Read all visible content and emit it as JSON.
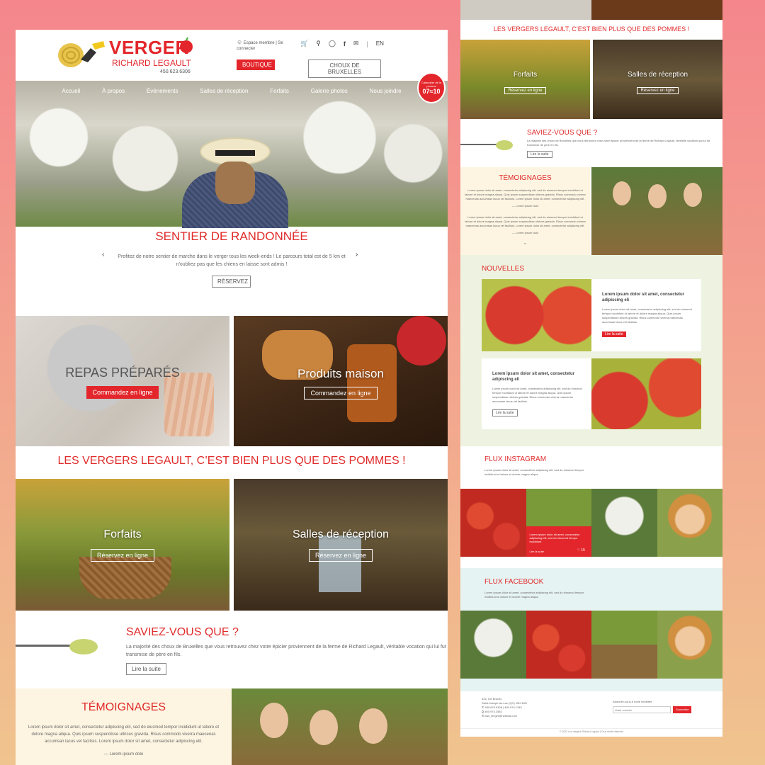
{
  "header": {
    "logo_main": "VERGER",
    "logo_sub": "RICHARD LEGAULT",
    "phone": "450.623.6306",
    "member_link": "Espace membre | Se connecter",
    "boutique": "BOUTIQUE",
    "choux": "CHOUX DE BRUXELLES",
    "lang": "EN",
    "cart_count": "0"
  },
  "nav": [
    "Accueil",
    "À propos",
    "Événements",
    "Salles de réception",
    "Forfaits",
    "Galerie photos",
    "Nous joindre"
  ],
  "calendar": {
    "label": "Calendrier de la pomme",
    "dates": "07≈10"
  },
  "hero": {
    "title": "SENTIER DE RANDONNÉE",
    "text": "Profitez de notre sentier de marche dans le verger tous les week-ends ! Le parcours total est de 5 km et n'oubliez pas que les chiens en laisse sont admis !",
    "button": "RÉSERVEZ"
  },
  "tiles": [
    {
      "title": "REPAS PRÉPARÉS",
      "button": "Commandez en ligne"
    },
    {
      "title": "Produits maison",
      "button": "Commandez en ligne"
    }
  ],
  "tagline": "LES VERGERS LEGAULT, C’EST BIEN PLUS QUE DES POMMES !",
  "offers": [
    {
      "title": "Forfaits",
      "button": "Réservez en ligne"
    },
    {
      "title": "Salles de réception",
      "button": "Réservez en ligne"
    }
  ],
  "saviez": {
    "title": "SAVIEZ-VOUS QUE ?",
    "text": "La majorité des choux de Bruxelles que vous retrouvez chez votre épicier proviennent de la ferme de Richard Legault, véritable vocation qui lui fut transmise de père en fils.",
    "text_right": "La majorité des choux de Bruxelles que vous retrouvez chez votre épicier proviennent de la ferme de Richard Legault, véritable vocation qui lui fut transmise de père en fils.",
    "button": "Lire la suite"
  },
  "testimonials": {
    "title": "TÉMOIGNAGES",
    "text": "Lorem ipsum dolor sit amet, consectetur adipiscing elit, sed do eiusmod tempor incididunt ut labore et dolore magna aliqua. Quis ipsum suspendisse ultrices gravida. Risus commodo viverra maecenas accumsan lacus vel facilisis. Lorem ipsum dolor sit amet, consectetur adipiscing elit.",
    "author": "— Lorem ipsum dolo"
  },
  "news": {
    "title": "NOUVELLES",
    "items": [
      {
        "headline": "Lorem ipsum dolor sit amet, consectetur adipiscing eli",
        "text": "Lorem ipsum dolor sit amet, consectetur adipiscing elit, sed do eiusmod tempor incididunt ut labore et dolore magna aliqua. Quis ipsum suspendisse ultrices gravida. Risus commodo viverra maecenas accumsan lacus vel facilisis.",
        "button": "Lire la suite"
      },
      {
        "headline": "Lorem ipsum dolor sit amet, consectetur adipiscing eli",
        "text": "Lorem ipsum dolor sit amet, consectetur adipiscing elit, sed do eiusmod tempor incididunt ut labore et dolore magna aliqua. Quis ipsum suspendisse ultrices gravida. Risus commodo viverra maecenas accumsan lacus vel facilisis.",
        "button": "Lire la suite"
      }
    ]
  },
  "instagram": {
    "title": "FLUX INSTAGRAM",
    "text": "Lorem ipsum dolor sit amet, consectetur adipiscing elit, sed do eiusmod tempor incididunt ut labore et dolore magna aliqua.",
    "card_text": "Lorem ipsum dolor sit amet, consectetur adipiscing elit, sed do eiusmod tempor incididunt",
    "card_link": "Lire la suite",
    "likes": "15"
  },
  "facebook": {
    "title": "FLUX FACEBOOK",
    "text": "Lorem ipsum dolor sit amet, consectetur adipiscing elit, sed do eiusmod tempor incididunt ut labore et dolore magna aliqua."
  },
  "footer": {
    "address1": "325, rue Brochu",
    "address2": "Saint-Joseph-du-Lac (QC) J0N 1M0",
    "phone": "450.623.6306 | 450.974.1345",
    "fax": "450.974.2582",
    "email": "bali_verger@hotmail.com",
    "newsletter_label": "Abonnez-vous à notre infolettre",
    "newsletter_placeholder": "Votre courriel",
    "subscribe": "Soumettre",
    "copyright": "© 2022 Les vergers Richard Legault | Tous droits réservés"
  },
  "colors": {
    "accent": "#e3262b",
    "cream": "#fdf5e2",
    "sage": "#eef3e1",
    "sky": "#e6f3f3"
  }
}
